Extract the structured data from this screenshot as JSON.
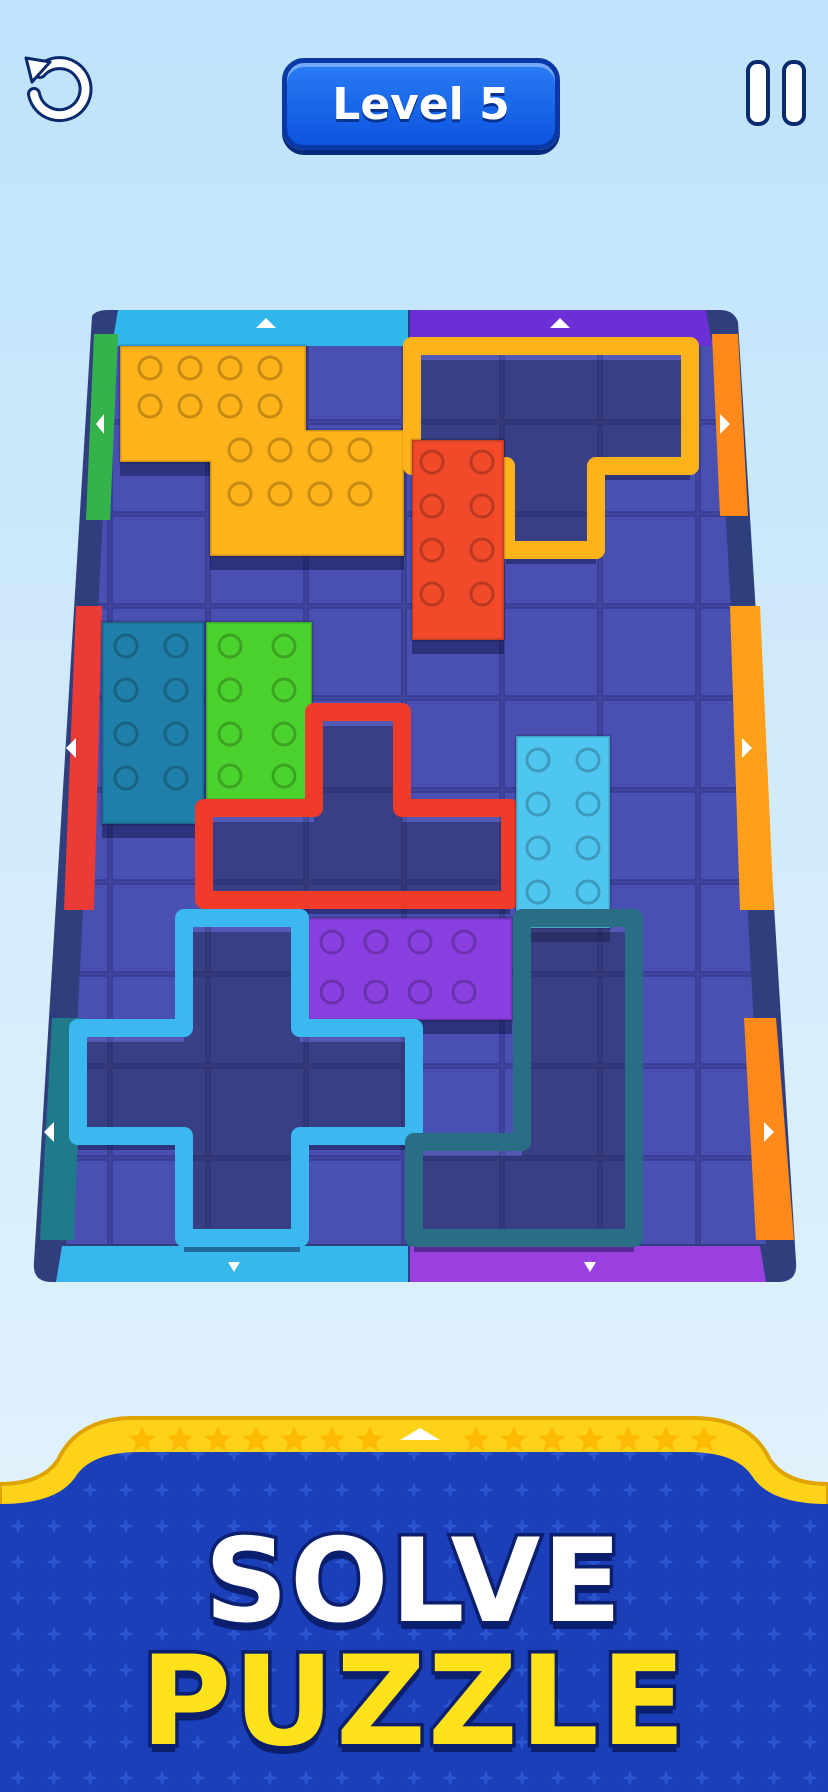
{
  "header": {
    "level_label": "Level 5",
    "restart_icon": "restart-arrow-icon",
    "pause_icon": "pause-icon"
  },
  "board": {
    "columns": 7,
    "rows": 10,
    "blocks": [
      {
        "name": "orange-s-block",
        "color": "#ffb31a",
        "style": "solid"
      },
      {
        "name": "orange-t-outline-block",
        "color": "#ffb31a",
        "style": "outline"
      },
      {
        "name": "red-bar-block",
        "color": "#f04a2a",
        "style": "solid"
      },
      {
        "name": "teal-bar-block",
        "color": "#1f7fa8",
        "style": "solid"
      },
      {
        "name": "green-bar-block",
        "color": "#4cd22e",
        "style": "solid"
      },
      {
        "name": "red-t-outline-block",
        "color": "#f03a2a",
        "style": "outline"
      },
      {
        "name": "cyan-bar-block",
        "color": "#4fc6ef",
        "style": "solid"
      },
      {
        "name": "purple-bar-block",
        "color": "#8a3fe0",
        "style": "solid"
      },
      {
        "name": "cyan-plus-outline-block",
        "color": "#3bb8f0",
        "style": "outline"
      },
      {
        "name": "teal-l-outline-block",
        "color": "#2a6e86",
        "style": "outline"
      }
    ],
    "gates": [
      {
        "name": "gate-top-cyan",
        "color": "#2fb6ea"
      },
      {
        "name": "gate-top-purple",
        "color": "#6a2fd6"
      },
      {
        "name": "gate-left-green",
        "color": "#34b34a"
      },
      {
        "name": "gate-left-red",
        "color": "#ea3b36"
      },
      {
        "name": "gate-left-teal",
        "color": "#1f7a8a"
      },
      {
        "name": "gate-right-orange-top",
        "color": "#ff8a1a"
      },
      {
        "name": "gate-right-orange-middle",
        "color": "#ff9f1a"
      },
      {
        "name": "gate-right-orange-bottom",
        "color": "#ff8a1a"
      },
      {
        "name": "gate-bottom-cyan",
        "color": "#36b8ec"
      },
      {
        "name": "gate-bottom-purple",
        "color": "#9a3fe0"
      }
    ]
  },
  "banner": {
    "title_line1": "SOLVE",
    "title_line2": "PUZZLE",
    "yellow": "#ffd21a",
    "blue": "#1a3fb8"
  }
}
